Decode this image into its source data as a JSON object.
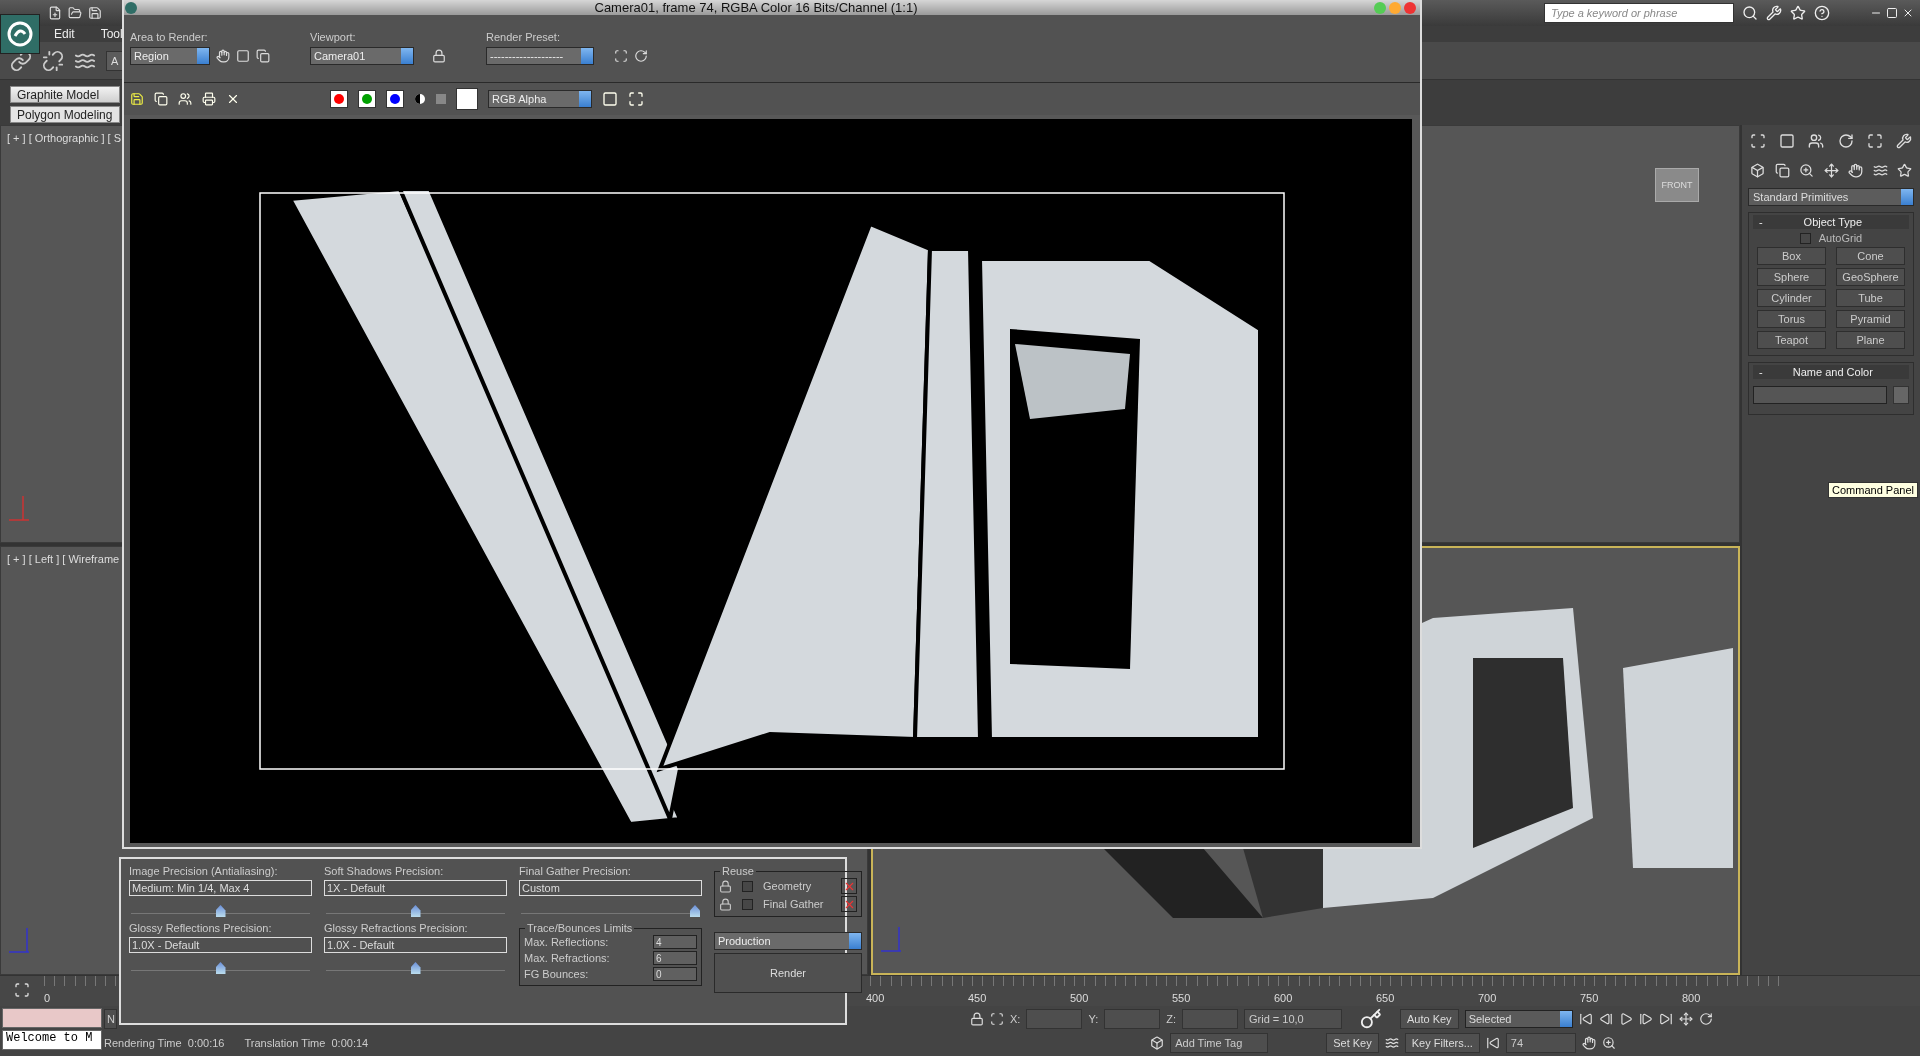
{
  "app": {
    "menu": [
      "Edit",
      "Tool"
    ],
    "selection_filter": "A",
    "search": {
      "placeholder": "Type a keyword or phrase"
    },
    "ribbon_tabs": [
      {
        "label": "Graphite Model",
        "selected": true
      },
      {
        "label": "Polygon Modeling",
        "selected": false
      }
    ]
  },
  "viewports": [
    {
      "label": "[ + ] [ Orthographic ] [ S"
    },
    {
      "label": "[ + ] [ Left ] [ Wireframe"
    }
  ],
  "viewcube": {
    "label": "FRONT"
  },
  "command_panel": {
    "dropdown": "Standard Primitives",
    "object_type": {
      "toggle": "-",
      "title": "Object Type",
      "autogrid": {
        "label": "AutoGrid",
        "checked": false
      },
      "buttons": [
        "Box",
        "Cone",
        "Sphere",
        "GeoSphere",
        "Cylinder",
        "Tube",
        "Torus",
        "Pyramid",
        "Teapot",
        "Plane"
      ]
    },
    "name_and_color": {
      "toggle": "-",
      "title": "Name and Color"
    },
    "tooltip": "Command Panel"
  },
  "render_window": {
    "title": "Camera01, frame 74, RGBA Color 16 Bits/Channel (1:1)",
    "area_to_render": {
      "label": "Area to Render:",
      "value": "Region"
    },
    "viewport": {
      "label": "Viewport:",
      "value": "Camera01"
    },
    "render_preset": {
      "label": "Render Preset:",
      "value": "--------------------"
    },
    "channels": [
      {
        "color": "#ff0000",
        "selected": true
      },
      {
        "color": "#00a000",
        "selected": true
      },
      {
        "color": "#0000ff",
        "selected": true
      }
    ],
    "display_channel": "RGB Alpha",
    "precision": [
      {
        "label": "Image Precision (Antialiasing):",
        "value": "Medium: Min 1/4, Max 4",
        "level": 0.5
      },
      {
        "label": "Soft Shadows Precision:",
        "value": "1X - Default",
        "level": 0.5
      },
      {
        "label": "Final Gather Precision:",
        "value": "Custom",
        "level": 1
      },
      {
        "label": "Glossy Reflections Precision:",
        "value": "1.0X - Default",
        "level": 0.5
      },
      {
        "label": "Glossy Refractions Precision:",
        "value": "1.0X - Default",
        "level": 0.5
      }
    ],
    "trace": {
      "title": "Trace/Bounces Limits",
      "fields": [
        {
          "label": "Max. Reflections:",
          "value": "4"
        },
        {
          "label": "Max. Refractions:",
          "value": "6"
        },
        {
          "label": "FG Bounces:",
          "value": "0"
        }
      ]
    },
    "reuse": {
      "title": "Reuse",
      "items": [
        {
          "label": "Geometry",
          "checked": false
        },
        {
          "label": "Final Gather",
          "checked": false
        }
      ]
    },
    "mode": "Production",
    "render_button": "Render"
  },
  "timeline": {
    "ticks": [
      "0",
      "400",
      "450",
      "500",
      "550",
      "600",
      "650",
      "700",
      "750",
      "800"
    ]
  },
  "status": {
    "welcome": "Welcome to M",
    "prompt": "N",
    "rendering_time": "Rendering Time  0:00:16",
    "translation_time": "Translation Time  0:00:14",
    "coords": [
      "X:",
      "Y:",
      "Z:"
    ],
    "grid": "Grid = 10,0",
    "add_time_tag": "Add Time Tag",
    "auto_key": "Auto Key",
    "set_key": "Set Key",
    "key_mode": "Selected",
    "key_filters": "Key Filters...",
    "frame": "74"
  }
}
